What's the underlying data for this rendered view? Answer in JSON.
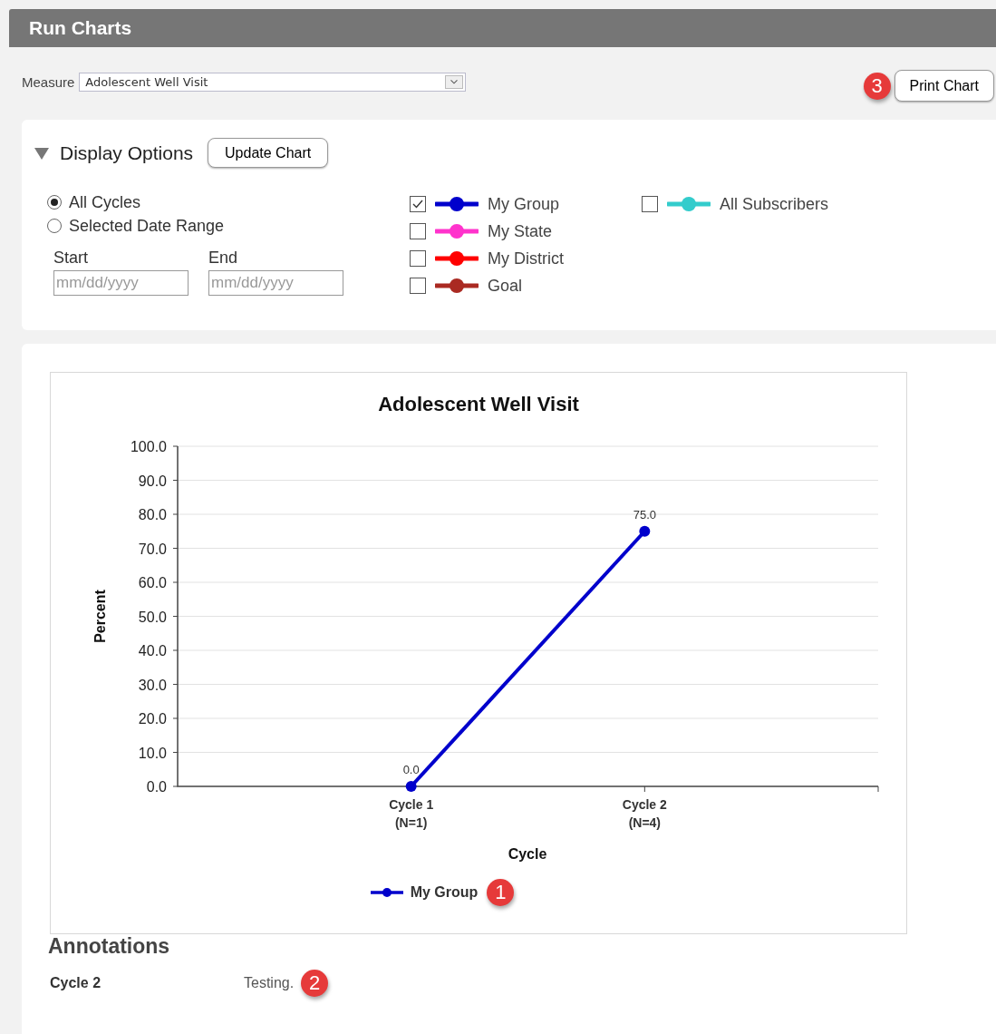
{
  "header": {
    "title": "Run Charts"
  },
  "measure": {
    "label": "Measure",
    "value": "Adolescent Well Visit"
  },
  "print_button": {
    "label": "Print Chart",
    "callout": "3"
  },
  "display_options": {
    "title": "Display Options",
    "expanded": true,
    "update_button": "Update Chart",
    "range_options": [
      {
        "label": "All Cycles",
        "selected": true
      },
      {
        "label": "Selected Date Range",
        "selected": false
      }
    ],
    "date_fields": [
      {
        "label": "Start",
        "placeholder": "mm/dd/yyyy"
      },
      {
        "label": "End",
        "placeholder": "mm/dd/yyyy"
      }
    ],
    "series_columns": [
      [
        {
          "label": "My Group",
          "checked": true,
          "color": "#0000cc"
        },
        {
          "label": "My State",
          "checked": false,
          "color": "#ff33cc"
        },
        {
          "label": "My District",
          "checked": false,
          "color": "#ff0000"
        },
        {
          "label": "Goal",
          "checked": false,
          "color": "#aa2a22"
        }
      ],
      [
        {
          "label": "All Subscribers",
          "checked": false,
          "color": "#33cccc"
        }
      ]
    ]
  },
  "chart": {
    "chart_data": {
      "type": "line",
      "title": "Adolescent Well Visit",
      "xlabel": "Cycle",
      "ylabel": "Percent",
      "categories": [
        "Cycle 1\n(N=1)",
        "Cycle 2\n(N=4)"
      ],
      "series": [
        {
          "name": "My Group",
          "color": "#0000cc",
          "marker": true,
          "values": [
            0,
            75
          ]
        }
      ],
      "grid": true,
      "ylim": [
        0,
        100
      ],
      "yticks": [
        {
          "value": 0,
          "label": "0.0"
        },
        {
          "value": 10,
          "label": "10.0"
        },
        {
          "value": 20,
          "label": "20.0"
        },
        {
          "value": 30,
          "label": "30.0"
        },
        {
          "value": 40,
          "label": "40.0"
        },
        {
          "value": 50,
          "label": "50.0"
        },
        {
          "value": 60,
          "label": "60.0"
        },
        {
          "value": 70,
          "label": "70.0"
        },
        {
          "value": 80,
          "label": "80.0"
        },
        {
          "value": 90,
          "label": "90.0"
        },
        {
          "value": 100,
          "label": "100.0"
        }
      ],
      "value_labels": [
        "0.0",
        "75.0"
      ]
    },
    "legend_callout": "1"
  },
  "annotations": {
    "title": "Annotations",
    "items": [
      {
        "cycle": "Cycle 2",
        "text": "Testing.",
        "callout": "2"
      }
    ]
  }
}
